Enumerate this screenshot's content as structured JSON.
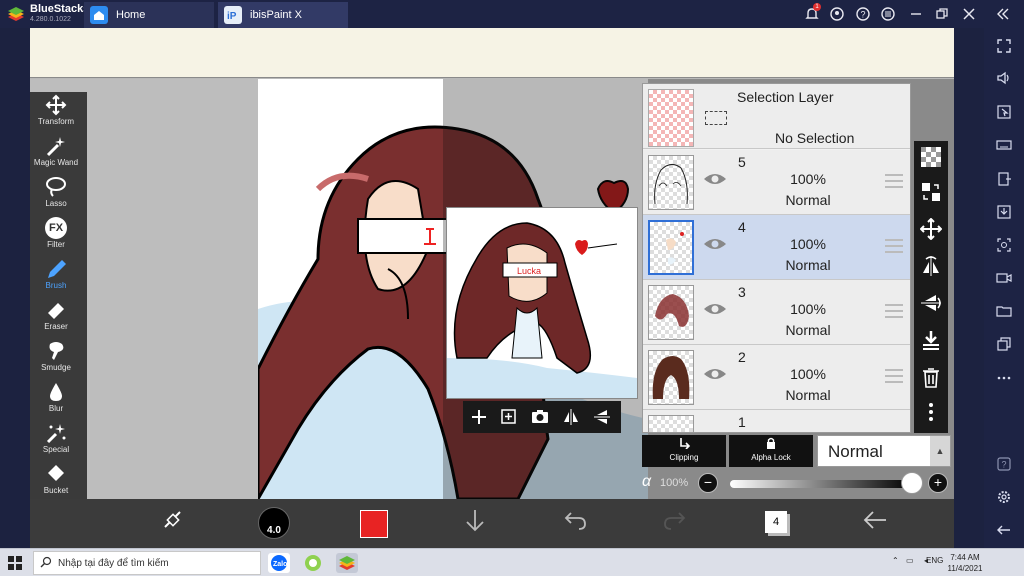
{
  "bluestacks": {
    "name": "BlueStacks",
    "version": "4.280.0.1022",
    "tabs": [
      {
        "label": "Home"
      },
      {
        "label": "ibisPaint X"
      }
    ],
    "notification_count": "1"
  },
  "ibis": {
    "tools": [
      {
        "label": "Transform",
        "icon": "transform-icon"
      },
      {
        "label": "Magic Wand",
        "icon": "magic-wand-icon"
      },
      {
        "label": "Lasso",
        "icon": "lasso-icon"
      },
      {
        "label": "Filter",
        "icon": "fx-icon",
        "glyph": "FX"
      },
      {
        "label": "Brush",
        "icon": "brush-icon"
      },
      {
        "label": "Eraser",
        "icon": "eraser-icon"
      },
      {
        "label": "Smudge",
        "icon": "smudge-icon"
      },
      {
        "label": "Blur",
        "icon": "blur-icon"
      },
      {
        "label": "Special",
        "icon": "special-icon"
      },
      {
        "label": "Bucket",
        "icon": "bucket-icon"
      },
      {
        "label": "",
        "icon": "text-icon",
        "glyph": "T"
      }
    ],
    "active_tool": "Brush",
    "brush_size": "4.0",
    "color": "#e82323",
    "layer_count": "4",
    "selection_layer": {
      "title": "Selection Layer",
      "status": "No Selection"
    },
    "layers": [
      {
        "num": "5",
        "opacity": "100%",
        "blend": "Normal",
        "selected": false
      },
      {
        "num": "4",
        "opacity": "100%",
        "blend": "Normal",
        "selected": true
      },
      {
        "num": "3",
        "opacity": "100%",
        "blend": "Normal",
        "selected": false
      },
      {
        "num": "2",
        "opacity": "100%",
        "blend": "Normal",
        "selected": false
      },
      {
        "num": "1",
        "opacity": "",
        "blend": "",
        "selected": false
      }
    ],
    "clipping_label": "Clipping",
    "alpha_lock_label": "Alpha Lock",
    "blend_mode": "Normal",
    "alpha_symbol": "α",
    "opacity_value": "100%",
    "opacity_fraction": 1.0,
    "preview_text": "Lucka"
  },
  "taskbar": {
    "search_placeholder": "Nhập tại đây để tìm kiếm",
    "lang": "ENG",
    "time": "7:44 AM",
    "date": "11/4/2021"
  }
}
